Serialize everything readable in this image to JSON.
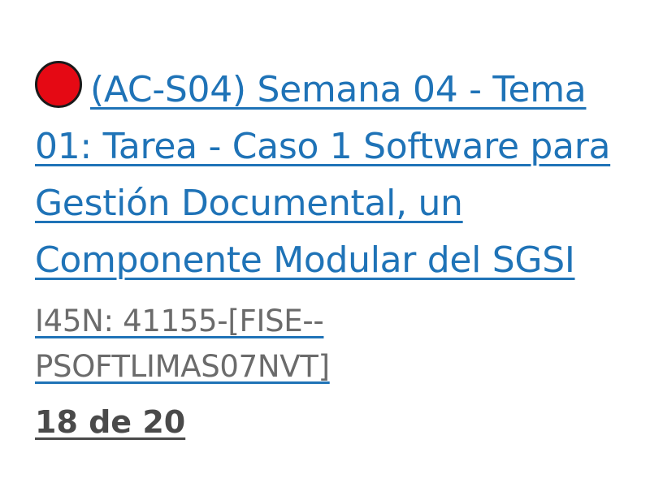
{
  "assignment": {
    "status_color": "#e50914",
    "title_lines": [
      "(AC-S04) Semana 04 - Tema",
      "01: Tarea - Caso 1 Software para",
      "Gestión Documental, un",
      "Componente Modular del SGSI"
    ]
  },
  "course": {
    "code_lines": [
      "I45N: 41155-[FISE--",
      "PSOFTLIMAS07NVT]"
    ]
  },
  "progress": {
    "text": "18 de 20"
  }
}
